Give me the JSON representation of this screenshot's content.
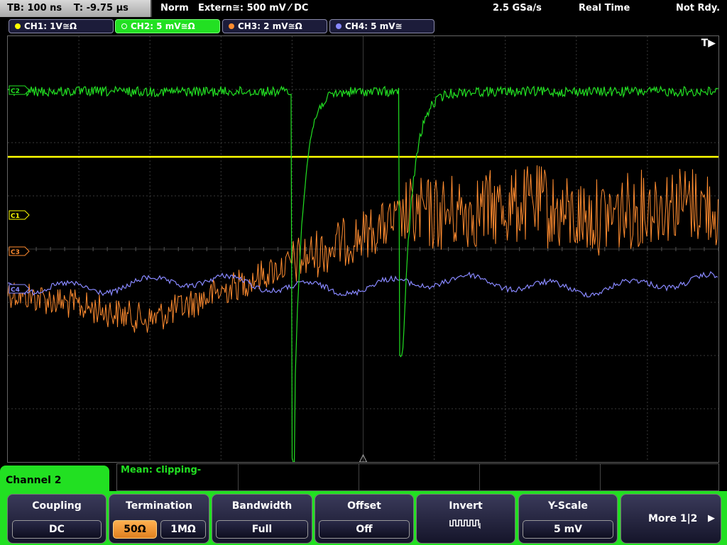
{
  "top": {
    "timebase": "TB: 100 ns",
    "trigger_time": "T: -9.75 µs",
    "mode": "Norm",
    "trigger_source": "Extern≅: 500 mV ⁄ DC",
    "sample_rate": "2.5 GSa/s",
    "acq_mode": "Real Time",
    "status": "Not Rdy."
  },
  "channels": [
    {
      "label": "CH1: 1V≅Ω",
      "color": "#ffff00",
      "active": false
    },
    {
      "label": "CH2: 5 mV≅Ω",
      "color": "#22e022",
      "active": true
    },
    {
      "label": "CH3: 2 mV≅Ω",
      "color": "#ff8c30",
      "active": false
    },
    {
      "label": "CH4: 5 mV≅",
      "color": "#8888ff",
      "active": false
    }
  ],
  "markers": {
    "c1": "C1",
    "c3": "C3",
    "c4": "C4",
    "c2": "C2",
    "t": "T▶"
  },
  "colors": {
    "ch1": "#ffff00",
    "ch2": "#22e022",
    "ch3": "#ff8c30",
    "ch4": "#8888ff",
    "grid": "#3a3a3a"
  },
  "measure": {
    "label": "Mean: clipping-"
  },
  "menu": {
    "title": "Channel 2",
    "coupling": {
      "title": "Coupling",
      "value": "DC"
    },
    "termination": {
      "title": "Termination",
      "opt1": "50Ω",
      "opt2": "1MΩ"
    },
    "bandwidth": {
      "title": "Bandwidth",
      "value": "Full"
    },
    "offset": {
      "title": "Offset",
      "value": "Off"
    },
    "invert": {
      "title": "Invert",
      "icon": "invert-square-wave-icon"
    },
    "yscale": {
      "title": "Y-Scale",
      "value": "5 mV"
    },
    "more": {
      "label": "More 1|2",
      "icon": "arrow-right-icon"
    }
  }
}
